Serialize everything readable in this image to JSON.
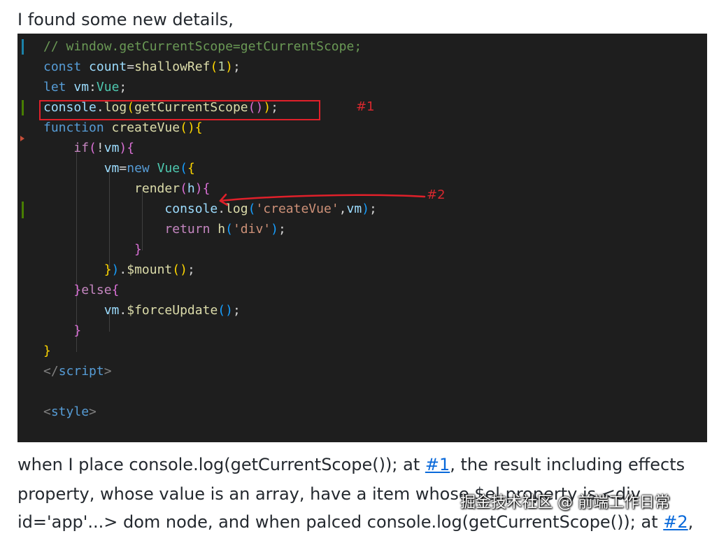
{
  "intro": "I found some new details,",
  "code": {
    "lines": [
      [
        [
          "// window.getCurrentScope=getCurrentScope;",
          "comment"
        ]
      ],
      [
        [
          "const ",
          "keyword"
        ],
        [
          "count",
          "ident"
        ],
        [
          "=",
          "punc"
        ],
        [
          "shallowRef",
          "fn"
        ],
        [
          "(",
          "bp1"
        ],
        [
          "1",
          "number"
        ],
        [
          ")",
          "bp1"
        ],
        [
          ";",
          "punc"
        ]
      ],
      [
        [
          "let ",
          "keyword"
        ],
        [
          "vm",
          "ident"
        ],
        [
          ":",
          "punc"
        ],
        [
          "Vue",
          "type"
        ],
        [
          ";",
          "punc"
        ]
      ],
      [
        [
          "console",
          "ident"
        ],
        [
          ".",
          "punc"
        ],
        [
          "log",
          "fn"
        ],
        [
          "(",
          "bp1"
        ],
        [
          "getCurrentScope",
          "fn"
        ],
        [
          "(",
          "bp2"
        ],
        [
          ")",
          "bp2"
        ],
        [
          ")",
          "bp1"
        ],
        [
          ";",
          "punc"
        ]
      ],
      [
        [
          "function ",
          "keyword"
        ],
        [
          "createVue",
          "fn"
        ],
        [
          "(",
          "bp1"
        ],
        [
          ")",
          "bp1"
        ],
        [
          "{",
          "bp1"
        ]
      ],
      [
        [
          "    ",
          "punc"
        ],
        [
          "if",
          "control"
        ],
        [
          "(",
          "bp2"
        ],
        [
          "!",
          "punc"
        ],
        [
          "vm",
          "ident"
        ],
        [
          ")",
          "bp2"
        ],
        [
          "{",
          "bp2"
        ]
      ],
      [
        [
          "        ",
          "punc"
        ],
        [
          "vm",
          "ident"
        ],
        [
          "=",
          "punc"
        ],
        [
          "new ",
          "keyword"
        ],
        [
          "Vue",
          "type"
        ],
        [
          "(",
          "bp3"
        ],
        [
          "{",
          "bp1"
        ]
      ],
      [
        [
          "            ",
          "punc"
        ],
        [
          "render",
          "fn"
        ],
        [
          "(",
          "bp2"
        ],
        [
          "h",
          "ident"
        ],
        [
          ")",
          "bp2"
        ],
        [
          "{",
          "bp2"
        ]
      ],
      [
        [
          "                ",
          "punc"
        ],
        [
          "console",
          "ident"
        ],
        [
          ".",
          "punc"
        ],
        [
          "log",
          "fn"
        ],
        [
          "(",
          "bp3"
        ],
        [
          "'createVue'",
          "string"
        ],
        [
          ",",
          "punc"
        ],
        [
          "vm",
          "ident"
        ],
        [
          ")",
          "bp3"
        ],
        [
          ";",
          "punc"
        ]
      ],
      [
        [
          "                ",
          "punc"
        ],
        [
          "return ",
          "control"
        ],
        [
          "h",
          "fn"
        ],
        [
          "(",
          "bp3"
        ],
        [
          "'div'",
          "string"
        ],
        [
          ")",
          "bp3"
        ],
        [
          ";",
          "punc"
        ]
      ],
      [
        [
          "            ",
          "punc"
        ],
        [
          "}",
          "bp2"
        ]
      ],
      [
        [
          "        ",
          "punc"
        ],
        [
          "}",
          "bp1"
        ],
        [
          ")",
          "bp3"
        ],
        [
          ".",
          "punc"
        ],
        [
          "$mount",
          "fn"
        ],
        [
          "(",
          "bp1"
        ],
        [
          ")",
          "bp1"
        ],
        [
          ";",
          "punc"
        ]
      ],
      [
        [
          "    ",
          "punc"
        ],
        [
          "}",
          "bp2"
        ],
        [
          "else",
          "control"
        ],
        [
          "{",
          "bp2"
        ]
      ],
      [
        [
          "        ",
          "punc"
        ],
        [
          "vm",
          "ident"
        ],
        [
          ".",
          "punc"
        ],
        [
          "$forceUpdate",
          "fn"
        ],
        [
          "(",
          "bp3"
        ],
        [
          ")",
          "bp3"
        ],
        [
          ";",
          "punc"
        ]
      ],
      [
        [
          "    ",
          "punc"
        ],
        [
          "}",
          "bp2"
        ]
      ],
      [
        [
          "}",
          "bp1"
        ]
      ],
      [
        [
          "</",
          "tag"
        ],
        [
          "script",
          "tagname"
        ],
        [
          ">",
          "tag"
        ]
      ],
      [
        [
          "",
          "punc"
        ]
      ],
      [
        [
          "<",
          "tag"
        ],
        [
          "style",
          "tagname"
        ],
        [
          ">",
          "tag"
        ]
      ]
    ]
  },
  "annotations": {
    "label1": "#1",
    "label2": "#2",
    "color": "#e0202a"
  },
  "paragraph": {
    "line1_before": "when I place console.log(getCurrentScope()); at ",
    "line1_link": "#1",
    "line1_after": ", the result including effects",
    "line2": "property, whose value is an array, have a item whose $el property is <div",
    "line3_before": "id='app'...> dom node, and when palced console.log(getCurrentScope()); at ",
    "line3_link": "#2",
    "line3_after": ","
  },
  "watermark": "掘金技术社区 @ 前端工作日常"
}
